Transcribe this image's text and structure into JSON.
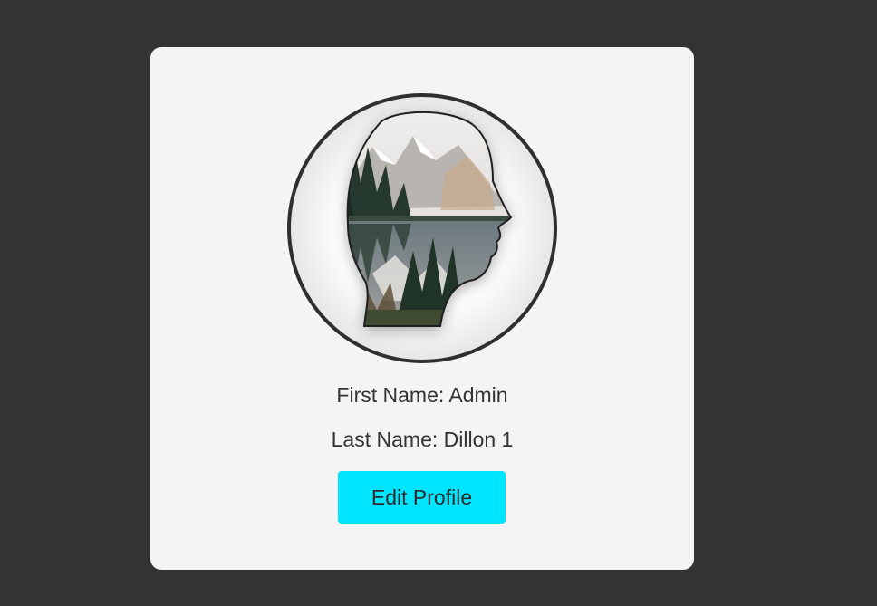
{
  "profile": {
    "first_name_line": "First Name: Admin",
    "last_name_line": "Last Name: Dillon 1",
    "avatar_alt": "head silhouette with mountain lake landscape"
  },
  "actions": {
    "edit_label": "Edit Profile"
  },
  "colors": {
    "page_background": "#333333",
    "card_background": "#f4f4f4",
    "button_accent": "#00e5ff",
    "text": "#333333"
  }
}
